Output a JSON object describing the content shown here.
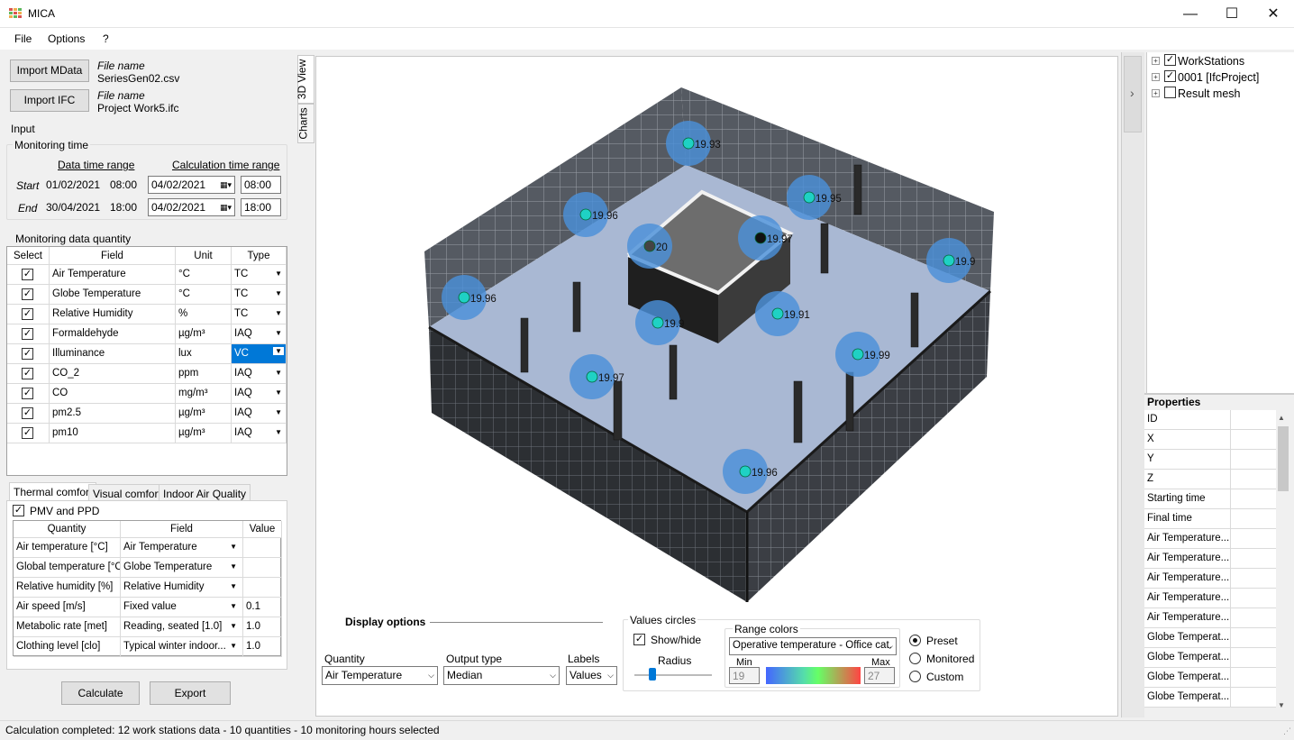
{
  "window": {
    "title": "MICA",
    "minimize": "—",
    "maximize": "☐",
    "close": "✕"
  },
  "menu": [
    "File",
    "Options",
    "?"
  ],
  "files": [
    {
      "button": "Import MData",
      "caption": "File name",
      "value": "SeriesGen02.csv"
    },
    {
      "button": "Import IFC",
      "caption": "File name",
      "value": "Project Work5.ifc"
    }
  ],
  "input": {
    "title": "Input",
    "monitoring_time": {
      "title": "Monitoring time",
      "data_range_header": "Data time range",
      "calc_range_header": "Calculation time range",
      "start": {
        "label": "Start",
        "date": "01/02/2021",
        "time": "08:00",
        "calc_date": "04/02/2021",
        "calc_time": "08:00"
      },
      "end": {
        "label": "End",
        "date": "30/04/2021",
        "time": "18:00",
        "calc_date": "04/02/2021",
        "calc_time": "18:00"
      }
    },
    "quantity": {
      "title": "Monitoring data quantity",
      "headers": [
        "Select",
        "Field",
        "Unit",
        "Type"
      ],
      "rows": [
        {
          "field": "Air Temperature",
          "unit": "°C",
          "type": "TC"
        },
        {
          "field": "Globe Temperature",
          "unit": "°C",
          "type": "TC"
        },
        {
          "field": "Relative Humidity",
          "unit": "%",
          "type": "TC"
        },
        {
          "field": "Formaldehyde",
          "unit": "µg/m³",
          "type": "IAQ"
        },
        {
          "field": "Illuminance",
          "unit": "lux",
          "type": "VC"
        },
        {
          "field": "CO_2",
          "unit": "ppm",
          "type": "IAQ"
        },
        {
          "field": "CO",
          "unit": "mg/m³",
          "type": "IAQ"
        },
        {
          "field": "pm2.5",
          "unit": "µg/m³",
          "type": "IAQ"
        },
        {
          "field": "pm10",
          "unit": "µg/m³",
          "type": "IAQ"
        }
      ]
    }
  },
  "comfort_tabs": [
    "Thermal comfort",
    "Visual comfort",
    "Indoor Air Quality"
  ],
  "thermal": {
    "pmv_label": "PMV and PPD",
    "headers": [
      "Quantity",
      "Field",
      "Value"
    ],
    "rows": [
      {
        "quantity": "Air temperature [°C]",
        "field": "Air Temperature",
        "value": ""
      },
      {
        "quantity": "Global temperature [°C]",
        "field": "Globe Temperature",
        "value": ""
      },
      {
        "quantity": "Relative humidity [%]",
        "field": "Relative Humidity",
        "value": ""
      },
      {
        "quantity": "Air speed [m/s]",
        "field": "Fixed value",
        "value": "0.1"
      },
      {
        "quantity": "Metabolic rate [met]",
        "field": "Reading, seated [1.0]",
        "value": "1.0"
      },
      {
        "quantity": "Clothing level [clo]",
        "field": "Typical winter indoor...",
        "value": "1.0"
      }
    ]
  },
  "actions": {
    "calculate": "Calculate",
    "export": "Export"
  },
  "view_tabs": [
    "3D View",
    "Charts"
  ],
  "sensors": [
    {
      "label": "19.93"
    },
    {
      "label": "19.95"
    },
    {
      "label": "19.96"
    },
    {
      "label": "20"
    },
    {
      "label": "19.97"
    },
    {
      "label": "19.9"
    },
    {
      "label": "19.96"
    },
    {
      "label": "19.9"
    },
    {
      "label": "19.91"
    },
    {
      "label": "19.99"
    },
    {
      "label": "19.97"
    },
    {
      "label": "19.96"
    }
  ],
  "display_options": {
    "title": "Display options",
    "quantity_label": "Quantity",
    "quantity_value": "Air Temperature",
    "output_label": "Output type",
    "output_value": "Median",
    "labels_label": "Labels",
    "labels_value": "Values"
  },
  "values_circles": {
    "title": "Values circles",
    "show_hide": "Show/hide",
    "radius_label": "Radius",
    "radius_level": 0.25
  },
  "range_colors": {
    "title": "Range colors",
    "preset_value": "Operative temperature - Office cat.",
    "min_label": "Min",
    "min_value": "19",
    "max_label": "Max",
    "max_value": "27",
    "options": [
      "Preset",
      "Monitored",
      "Custom"
    ]
  },
  "tree": [
    {
      "label": "WorkStations",
      "checked": true
    },
    {
      "label": "0001 [IfcProject]",
      "checked": true
    },
    {
      "label": "Result mesh",
      "checked": false
    }
  ],
  "properties": {
    "title": "Properties",
    "rows": [
      "ID",
      "X",
      "Y",
      "Z",
      "Starting time",
      "Final time",
      "Air Temperature...",
      "Air Temperature...",
      "Air Temperature...",
      "Air Temperature...",
      "Air Temperature...",
      "Globe Temperat...",
      "Globe Temperat...",
      "Globe Temperat...",
      "Globe Temperat..."
    ]
  },
  "expander": "›",
  "status": "Calculation completed: 12 work stations data - 10 quantities - 10 monitoring hours selected",
  "colors": {
    "accent": "#0078d7",
    "sensor_halo": "#4a90d9",
    "floor": "#a9b8d3"
  }
}
